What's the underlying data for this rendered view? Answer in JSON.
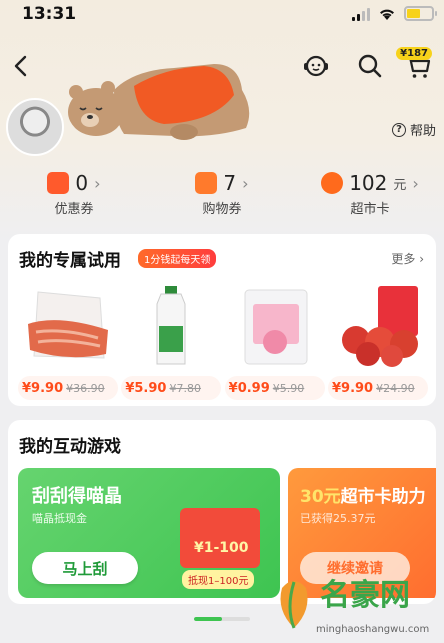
{
  "status_bar": {
    "time": "13:31"
  },
  "nav": {
    "cart_badge": "¥187"
  },
  "header": {
    "help_label": "帮助"
  },
  "stats": [
    {
      "value": "0",
      "unit": "",
      "label": "优惠券",
      "icon_color": "#ff5a2c",
      "icon": "coupon-icon"
    },
    {
      "value": "7",
      "unit": "",
      "label": "购物券",
      "icon_color": "#ff7a2c",
      "icon": "shopping-bag-icon"
    },
    {
      "value": "102",
      "unit": "元",
      "label": "超市卡",
      "icon_color": "#ff6a1c",
      "icon": "supermarket-card-icon"
    }
  ],
  "trial": {
    "title": "我的专属试用",
    "tag": "1分钱起每天领",
    "more": "更多",
    "products": [
      {
        "price": "¥9.90",
        "orig": "¥36.90"
      },
      {
        "price": "¥5.90",
        "orig": "¥7.80"
      },
      {
        "price": "¥0.99",
        "orig": "¥5.90"
      },
      {
        "price": "¥9.90",
        "orig": "¥24.90"
      }
    ]
  },
  "games": {
    "title": "我的互动游戏",
    "card1": {
      "title": "刮刮得喵晶",
      "subtitle": "喵晶抵现金",
      "button": "马上刮",
      "amount": "¥1-100",
      "tag": "抵现1–100元"
    },
    "card2": {
      "title_highlight": "30元",
      "title_rest": "超市卡助力",
      "subtitle": "已获得25.37元",
      "button": "继续邀请"
    }
  },
  "watermark": {
    "text": "名豪网",
    "url": "minghaoshangwu.com"
  },
  "colors": {
    "accent_orange": "#ff4c1a",
    "game_green": "#3ec451",
    "badge_yellow": "#f7d21a"
  }
}
